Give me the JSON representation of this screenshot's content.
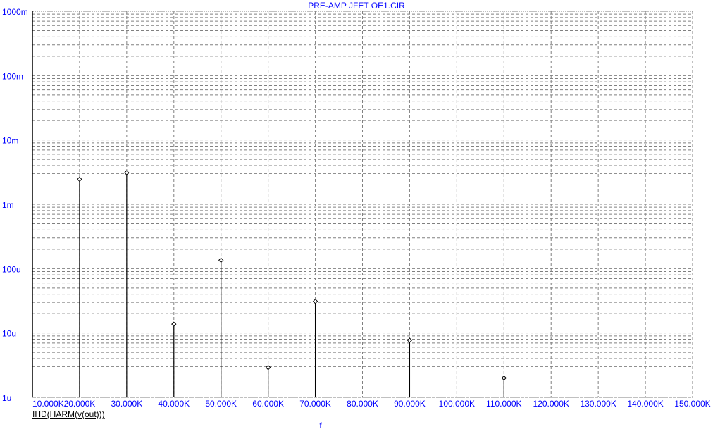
{
  "chart_data": {
    "type": "stem",
    "title": "PRE-AMP JFET OE1.CIR",
    "xlabel": "f",
    "trace_label": "IHD(HARM(v(out)))",
    "xlim": [
      10000,
      150000
    ],
    "ylim": [
      1e-06,
      1
    ],
    "yscale": "log",
    "grid": true,
    "x_tick_values": [
      10000,
      20000,
      30000,
      40000,
      50000,
      60000,
      70000,
      80000,
      90000,
      100000,
      110000,
      120000,
      130000,
      140000,
      150000
    ],
    "x_tick_labels": [
      "10.000K",
      "20.000K",
      "30.000K",
      "40.000K",
      "50.000K",
      "60.000K",
      "70.000K",
      "80.000K",
      "90.000K",
      "100.000K",
      "110.000K",
      "120.000K",
      "130.000K",
      "140.000K",
      "150.000K"
    ],
    "y_tick_values": [
      1e-06,
      1e-05,
      0.0001,
      0.001,
      0.01,
      0.1,
      1
    ],
    "y_tick_labels": [
      "1u",
      "10u",
      "100u",
      "1m",
      "10m",
      "100m",
      "1000m"
    ],
    "x": [
      20000,
      30000,
      40000,
      50000,
      60000,
      70000,
      90000,
      110000
    ],
    "values": [
      0.00245,
      0.0031,
      1.37e-05,
      0.000135,
      2.9e-06,
      3.1e-05,
      7.7e-06,
      2e-06
    ],
    "colors": {
      "axis_text": "#0000ff",
      "grid": "#808080",
      "stem": "#000000"
    }
  }
}
